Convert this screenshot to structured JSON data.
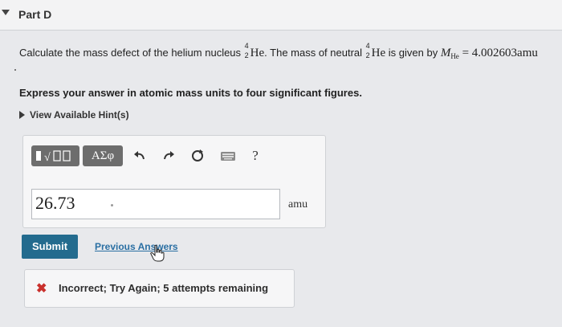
{
  "part": {
    "title": "Part D"
  },
  "question": {
    "text_before": "Calculate the mass defect of the helium nucleus ",
    "element_symbol": "He",
    "mass_number": "4",
    "atomic_number": "2",
    "text_middle": ". The mass of neutral ",
    "text_given": " is given by ",
    "mass_symbol": "M",
    "mass_subscript": "He",
    "equals": " = ",
    "given_value": "4.002603amu"
  },
  "instruction": "Express your answer in atomic mass units to four significant figures.",
  "hint": {
    "label": "View Available Hint(s)"
  },
  "toolbar": {
    "greek_label": "ΑΣφ",
    "undo_icon": "undo-arrow-icon",
    "redo_icon": "redo-arrow-icon",
    "reset_icon": "reset-icon",
    "keyboard_icon": "keyboard-icon",
    "help_label": "?"
  },
  "answer": {
    "value": "26.73",
    "unit": "amu"
  },
  "actions": {
    "submit_label": "Submit",
    "previous_label": "Previous Answers"
  },
  "feedback": {
    "icon": "x-mark-icon",
    "message": "Incorrect; Try Again; 5 attempts remaining"
  },
  "colors": {
    "submit_bg": "#236b8e",
    "link": "#2a6fa3",
    "error": "#c9302c",
    "toolbar_btn": "#6d6d6d"
  }
}
